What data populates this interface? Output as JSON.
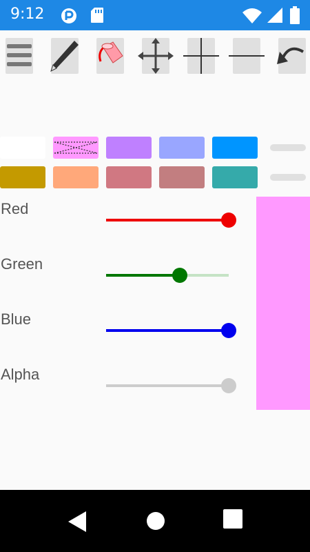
{
  "status_bar": {
    "time": "9:12",
    "icons": [
      "app-notification-icon",
      "sd-card-icon",
      "wifi-icon",
      "cell-signal-icon",
      "battery-icon"
    ],
    "background": "#1e88e5"
  },
  "toolbar": {
    "tools": [
      "menu-icon",
      "pencil-icon",
      "paint-bucket-icon",
      "move-icon",
      "vertical-line-icon",
      "horizontal-line-icon",
      "undo-icon"
    ]
  },
  "palette": {
    "row1": [
      "#ffffff",
      "#ff99ff",
      "#bf80ff",
      "#99a6ff",
      "#0095ff"
    ],
    "row2": [
      "#c49a00",
      "#ffa87a",
      "#d07882",
      "#c27e80",
      "#35aaaa"
    ],
    "selected": "#ff99ff"
  },
  "sliders": {
    "red": {
      "label": "Red",
      "value": 1.0,
      "color": "#ee0000",
      "track": "#ee0000"
    },
    "green": {
      "label": "Green",
      "value": 0.6,
      "color": "#007700",
      "track": "#c5e3c5"
    },
    "blue": {
      "label": "Blue",
      "value": 1.0,
      "color": "#0000ee",
      "track": "#0000ee"
    },
    "alpha": {
      "label": "Alpha",
      "value": 1.0,
      "color": "#cccccc",
      "track": "#d6d6d6"
    }
  },
  "preview": {
    "color": "#ff99ff"
  },
  "nav": {
    "buttons": [
      "back-icon",
      "home-icon",
      "recents-icon"
    ]
  }
}
